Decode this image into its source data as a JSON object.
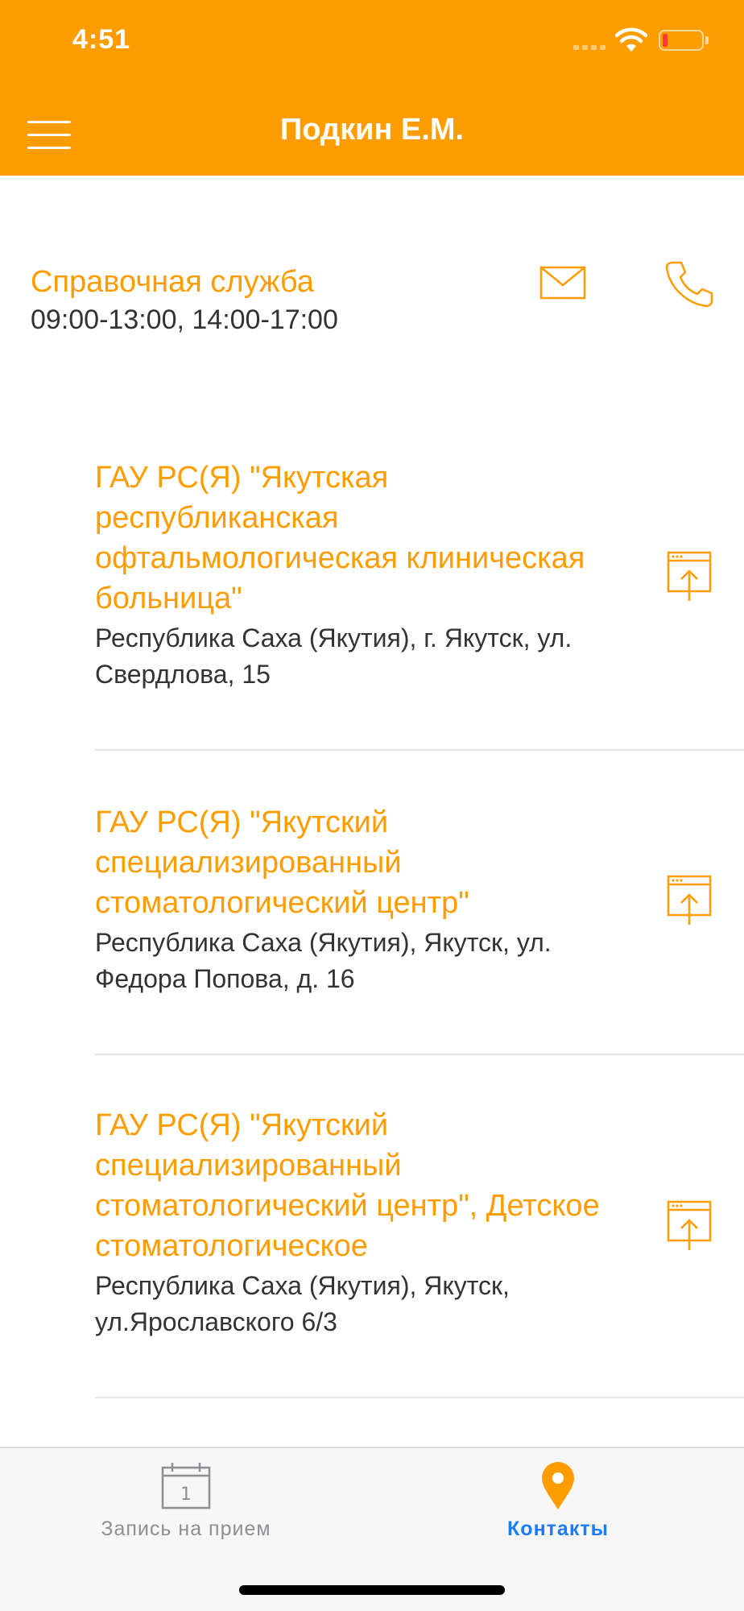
{
  "status_bar": {
    "time": "4:51"
  },
  "header": {
    "title": "Подкин Е.М."
  },
  "info_service": {
    "title": "Справочная служба",
    "hours": "09:00-13:00, 14:00-17:00"
  },
  "organizations": [
    {
      "name": "ГАУ РС(Я) \"Якутская республиканская офтальмологическая клиническая больница\"",
      "address": "Республика Саха (Якутия), г. Якутск, ул. Свердлова, 15"
    },
    {
      "name": "ГАУ РС(Я) \"Якутский специализированный стоматологический центр\"",
      "address": "Республика Саха (Якутия), Якутск, ул. Федора Попова, д. 16"
    },
    {
      "name": "ГАУ РС(Я) \"Якутский специализированный стоматологический центр\", Детское стоматологическое",
      "address": "Республика Саха (Якутия), Якутск, ул.Ярославского 6/3"
    }
  ],
  "tabbar": {
    "tabs": [
      {
        "label": "Запись на прием",
        "calendar_day": "1",
        "active": false
      },
      {
        "label": "Контакты",
        "active": true
      }
    ]
  },
  "colors": {
    "accent": "#FF9C00",
    "active_tab": "#1C7CF4",
    "inactive_tab": "#8E8E93"
  },
  "icons": {
    "menu": "hamburger-menu-icon",
    "mail": "envelope-icon",
    "phone": "phone-icon",
    "open": "open-in-browser-icon",
    "calendar": "calendar-icon",
    "location": "location-pin-icon"
  }
}
